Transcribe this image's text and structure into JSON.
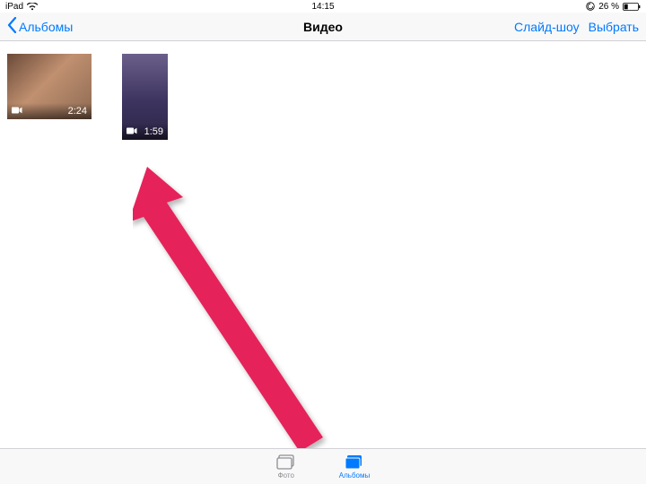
{
  "status": {
    "device": "iPad",
    "time": "14:15",
    "battery_pct": "26 %"
  },
  "nav": {
    "back_label": "Альбомы",
    "title": "Видео",
    "slideshow_label": "Слайд-шоу",
    "select_label": "Выбрать"
  },
  "videos": [
    {
      "duration": "2:24"
    },
    {
      "duration": "1:59"
    }
  ],
  "tabs": {
    "photos_label": "Фото",
    "albums_label": "Альбомы"
  }
}
